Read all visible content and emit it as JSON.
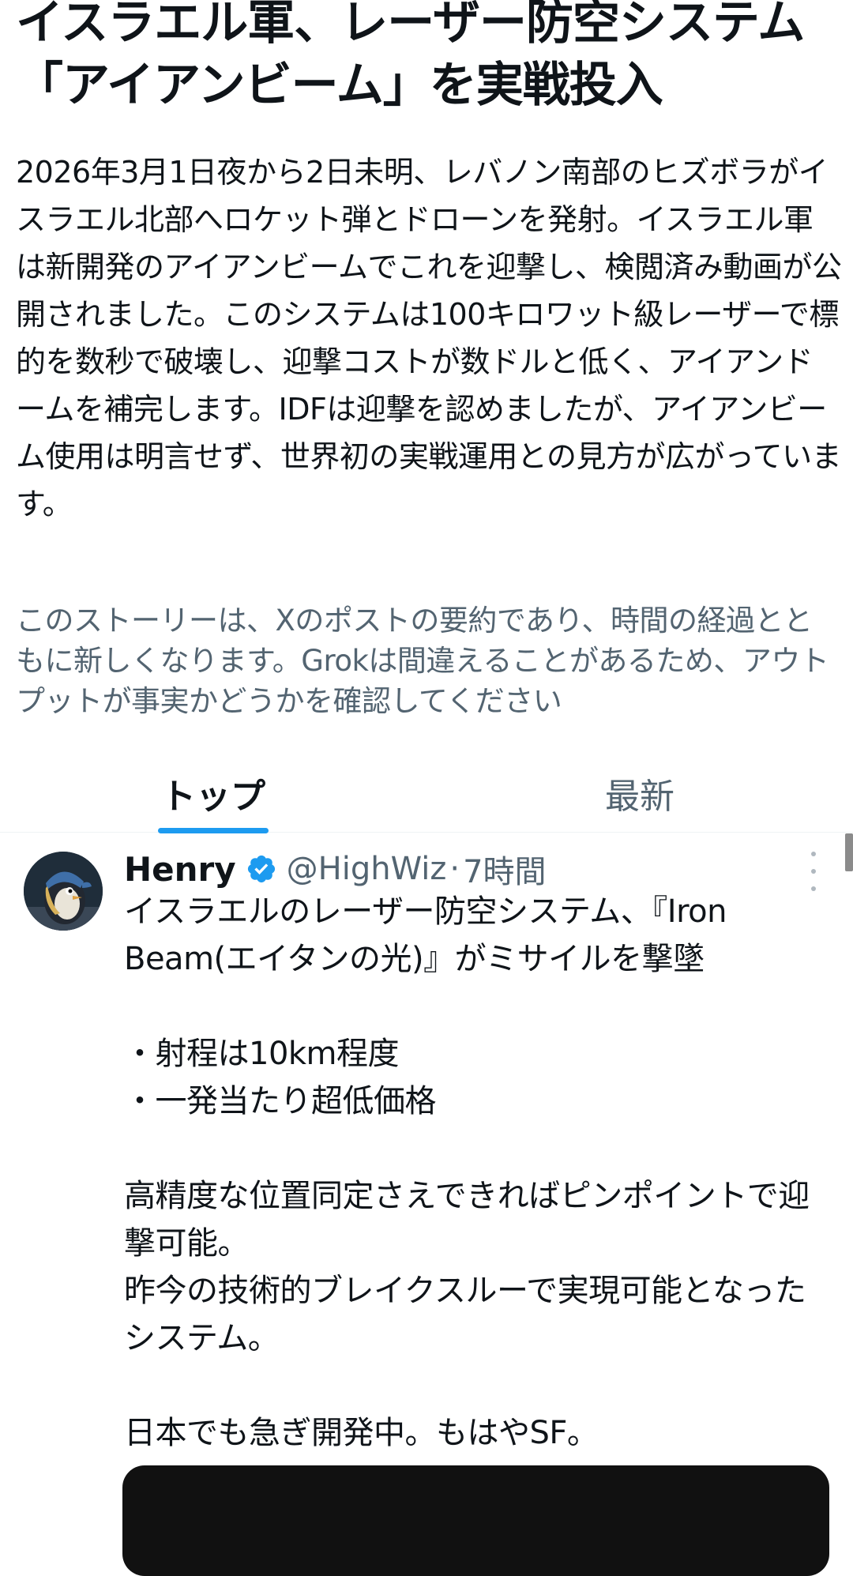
{
  "story": {
    "title": "イスラエル軍、レーザー防空システム「アイアンビーム」を実戦投入",
    "body": "2026年3月1日夜から2日未明、レバノン南部のヒズボラがイスラエル北部へロケット弾とドローンを発射。イスラエル軍は新開発のアイアンビームでこれを迎撃し、検閲済み動画が公開されました。このシステムは100キロワット級レーザーで標的を数秒で破壊し、迎撃コストが数ドルと低く、アイアンドームを補完します。IDFは迎撃を認めましたが、アイアンビーム使用は明言せず、世界初の実戦運用との見方が広がっています。",
    "disclaimer": "このストーリーは、Xのポストの要約であり、時間の経過とともに新しくなります。Grokは間違えることがあるため、アウトプットが事実かどうかを確認してください"
  },
  "tabs": [
    {
      "label": "トップ",
      "active": true
    },
    {
      "label": "最新",
      "active": false
    }
  ],
  "post": {
    "author": "Henry",
    "handle": "@HighWiz",
    "separator": "·",
    "time": "7時間",
    "text": "イスラエルのレーザー防空システム、『Iron Beam(エイタンの光)』がミサイルを撃墜\n\n・射程は10km程度\n・一発当たり超低価格\n\n高精度な位置同定さえできればピンポイントで迎撃可能。\n昨今の技術的ブレイクスルーで実現可能となったシステム。\n\n日本でも急ぎ開発中。もはやSF。",
    "verified": true,
    "icons": {
      "verified": "verified-badge-icon",
      "more": "more-options-icon"
    }
  },
  "colors": {
    "accent": "#1d9bf0",
    "secondary_text": "#536471",
    "primary_text": "#0f1419"
  }
}
